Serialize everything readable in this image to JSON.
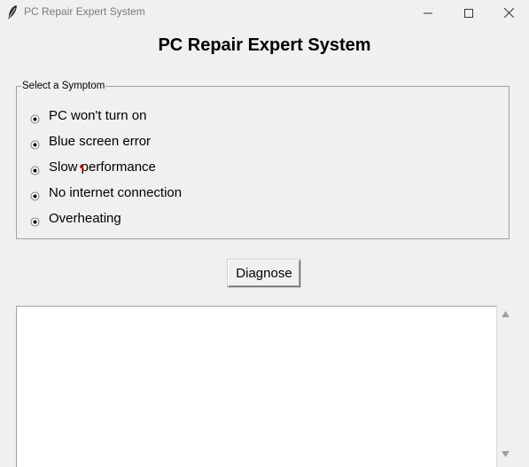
{
  "window": {
    "title": "PC Repair Expert System",
    "icon": "feather-icon",
    "controls": [
      "minimize-icon",
      "maximize-icon",
      "close-icon"
    ]
  },
  "header": {
    "title": "PC Repair Expert System"
  },
  "symptoms": {
    "label": "Select a Symptom",
    "options": [
      {
        "label": "PC won't turn on"
      },
      {
        "label": "Blue screen error"
      },
      {
        "label": "Slow performance"
      },
      {
        "label": "No internet connection"
      },
      {
        "label": "Overheating"
      }
    ]
  },
  "actions": {
    "diagnose_label": "Diagnose"
  },
  "output": {
    "text": ""
  },
  "colors": {
    "background": "#f0f0f0",
    "border": "#a0a0a0",
    "text_area": "#ffffff",
    "cursor_dot": "#e00000"
  }
}
